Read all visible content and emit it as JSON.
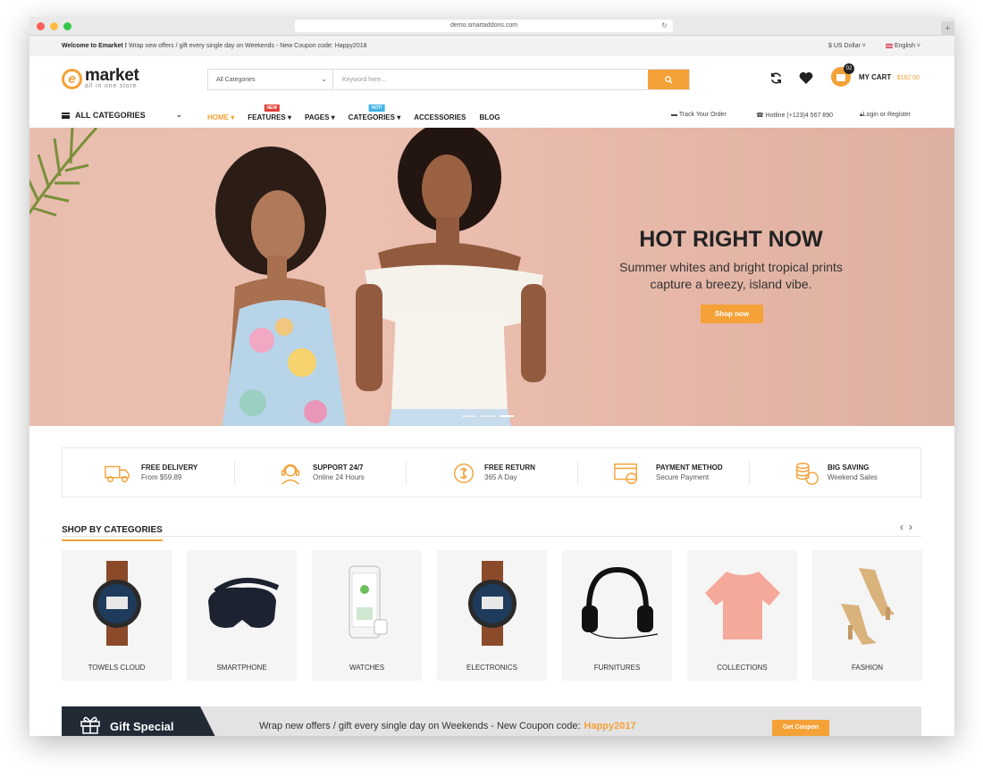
{
  "browser": {
    "url": "demo.smartaddons.com"
  },
  "topbar": {
    "welcome_bold": "Welcome to Emarket !",
    "welcome_rest": " Wrap new offers / gift every single day on Weekends - New Coupon code: Happy2018",
    "currency": "$ US Dollar ˅",
    "language": "English ˅"
  },
  "logo": {
    "word": "market",
    "letter": "e",
    "tagline": "all in one store"
  },
  "search": {
    "category": "All Categories",
    "placeholder": "Keyword here..."
  },
  "cart": {
    "count": "02",
    "label": "MY CART",
    "price": "- $162.00"
  },
  "nav": {
    "all_categories": "ALL CATEGORIES",
    "items": [
      {
        "label": "HOME ▾",
        "badge": ""
      },
      {
        "label": "FEATURES ▾",
        "badge": "NEW"
      },
      {
        "label": "PAGES ▾",
        "badge": ""
      },
      {
        "label": "CATEGORIES ▾",
        "badge": "HOT!"
      },
      {
        "label": "ACCESSORIES",
        "badge": ""
      },
      {
        "label": "BLOG",
        "badge": ""
      }
    ],
    "track": "Track Your Order",
    "hotline": "Hotline (+123)4 567 890",
    "login": "Login or Register"
  },
  "hero": {
    "title": "HOT RIGHT NOW",
    "subtitle_line1": "Summer whites and bright tropical prints",
    "subtitle_line2": "capture a breezy, island vibe.",
    "button": "Shop now"
  },
  "features": [
    {
      "title": "FREE DELIVERY",
      "sub": "From $59.89",
      "icon": "truck-icon"
    },
    {
      "title": "SUPPORT 24/7",
      "sub": "Online 24 Hours",
      "icon": "headset-icon"
    },
    {
      "title": "FREE RETURN",
      "sub": "365 A Day",
      "icon": "return-icon"
    },
    {
      "title": "PAYMENT METHOD",
      "sub": "Secure Payment",
      "icon": "card-icon"
    },
    {
      "title": "BIG SAVING",
      "sub": "Weekend Sales",
      "icon": "coins-icon"
    }
  ],
  "categories": {
    "title": "SHOP BY CATEGORIES",
    "items": [
      "TOWELS CLOUD",
      "SMARTPHONE",
      "WATCHES",
      "ELECTRONICS",
      "FURNITURES",
      "COLLECTIONS",
      "FASHION"
    ]
  },
  "gift": {
    "label": "Gift Special",
    "text": "Wrap new offers / gift every single day on Weekends - New Coupon code:",
    "code": "Happy2017",
    "button": "Get Coupon"
  },
  "colors": {
    "accent": "#f4a137",
    "dark": "#222a36",
    "hero_bg": "#e8bdae"
  }
}
